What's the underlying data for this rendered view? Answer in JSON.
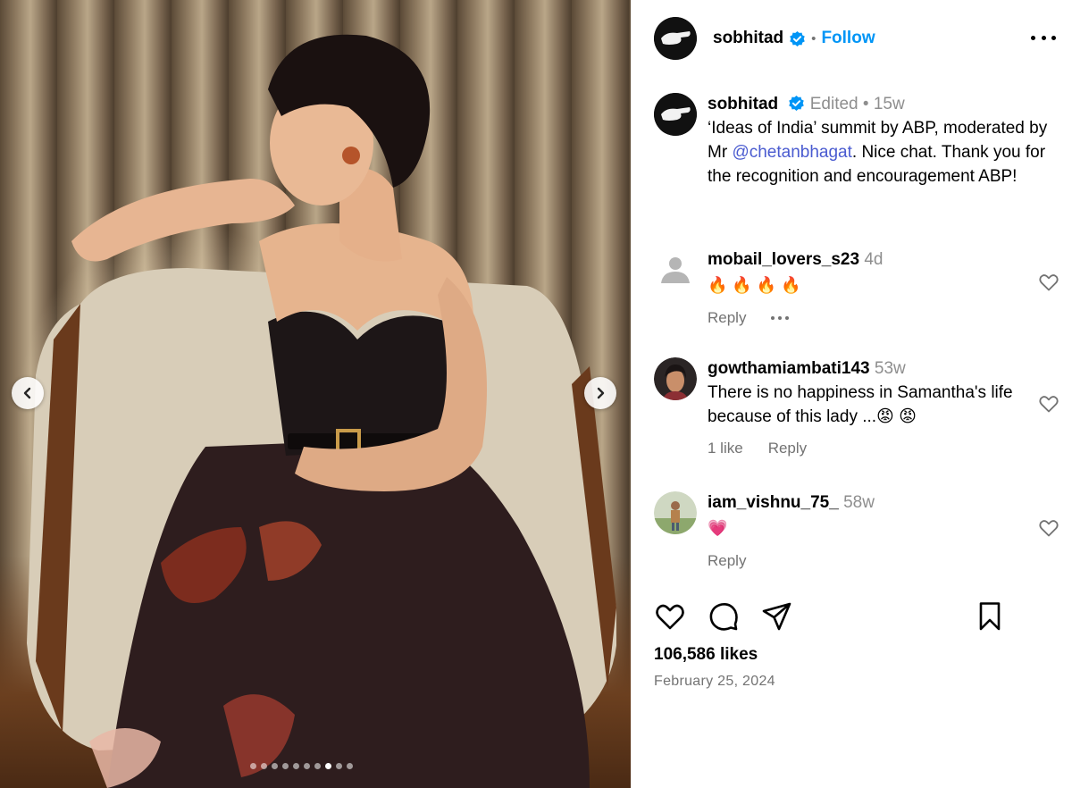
{
  "post": {
    "author": "sobhitad",
    "follow_label": "Follow",
    "separator": "•",
    "edited_label": "Edited",
    "age": "15w",
    "caption_intro": "‘Ideas of India’ summit by ABP, moderated by Mr ",
    "caption_mention": "@chetanbhagat",
    "caption_after": ". Nice chat. Thank you for the recognition and encouragement ABP!",
    "likes": "106,586 likes",
    "date": "February 25, 2024",
    "carousel": {
      "count": 10,
      "active_index": 7
    }
  },
  "comments": [
    {
      "username": "mobail_lovers_s23",
      "age": "4d",
      "text": "🔥 🔥 🔥 🔥",
      "reply_label": "Reply",
      "avatar": "default-avatar-icon"
    },
    {
      "username": "gowthamiambati143",
      "age": "53w",
      "text": "There is no happiness in Samantha's life because of this lady ...😡 😡",
      "likes_label": "1 like",
      "reply_label": "Reply",
      "avatar": "profile-photo"
    },
    {
      "username": "iam_vishnu_75_",
      "age": "58w",
      "text": "💗",
      "reply_label": "Reply",
      "avatar": "profile-photo"
    }
  ],
  "icons": {
    "verified": "verified-badge-icon",
    "more": "more-options-icon",
    "comment_like": "heart-outline-icon",
    "like": "heart-icon",
    "comment": "comment-bubble-icon",
    "share": "send-icon",
    "save": "bookmark-icon",
    "prev": "chevron-left-icon",
    "next": "chevron-right-icon"
  },
  "colors": {
    "follow": "#0095f6",
    "mention": "#4a5bd0",
    "muted": "#737373",
    "verified": "#0095f6"
  }
}
